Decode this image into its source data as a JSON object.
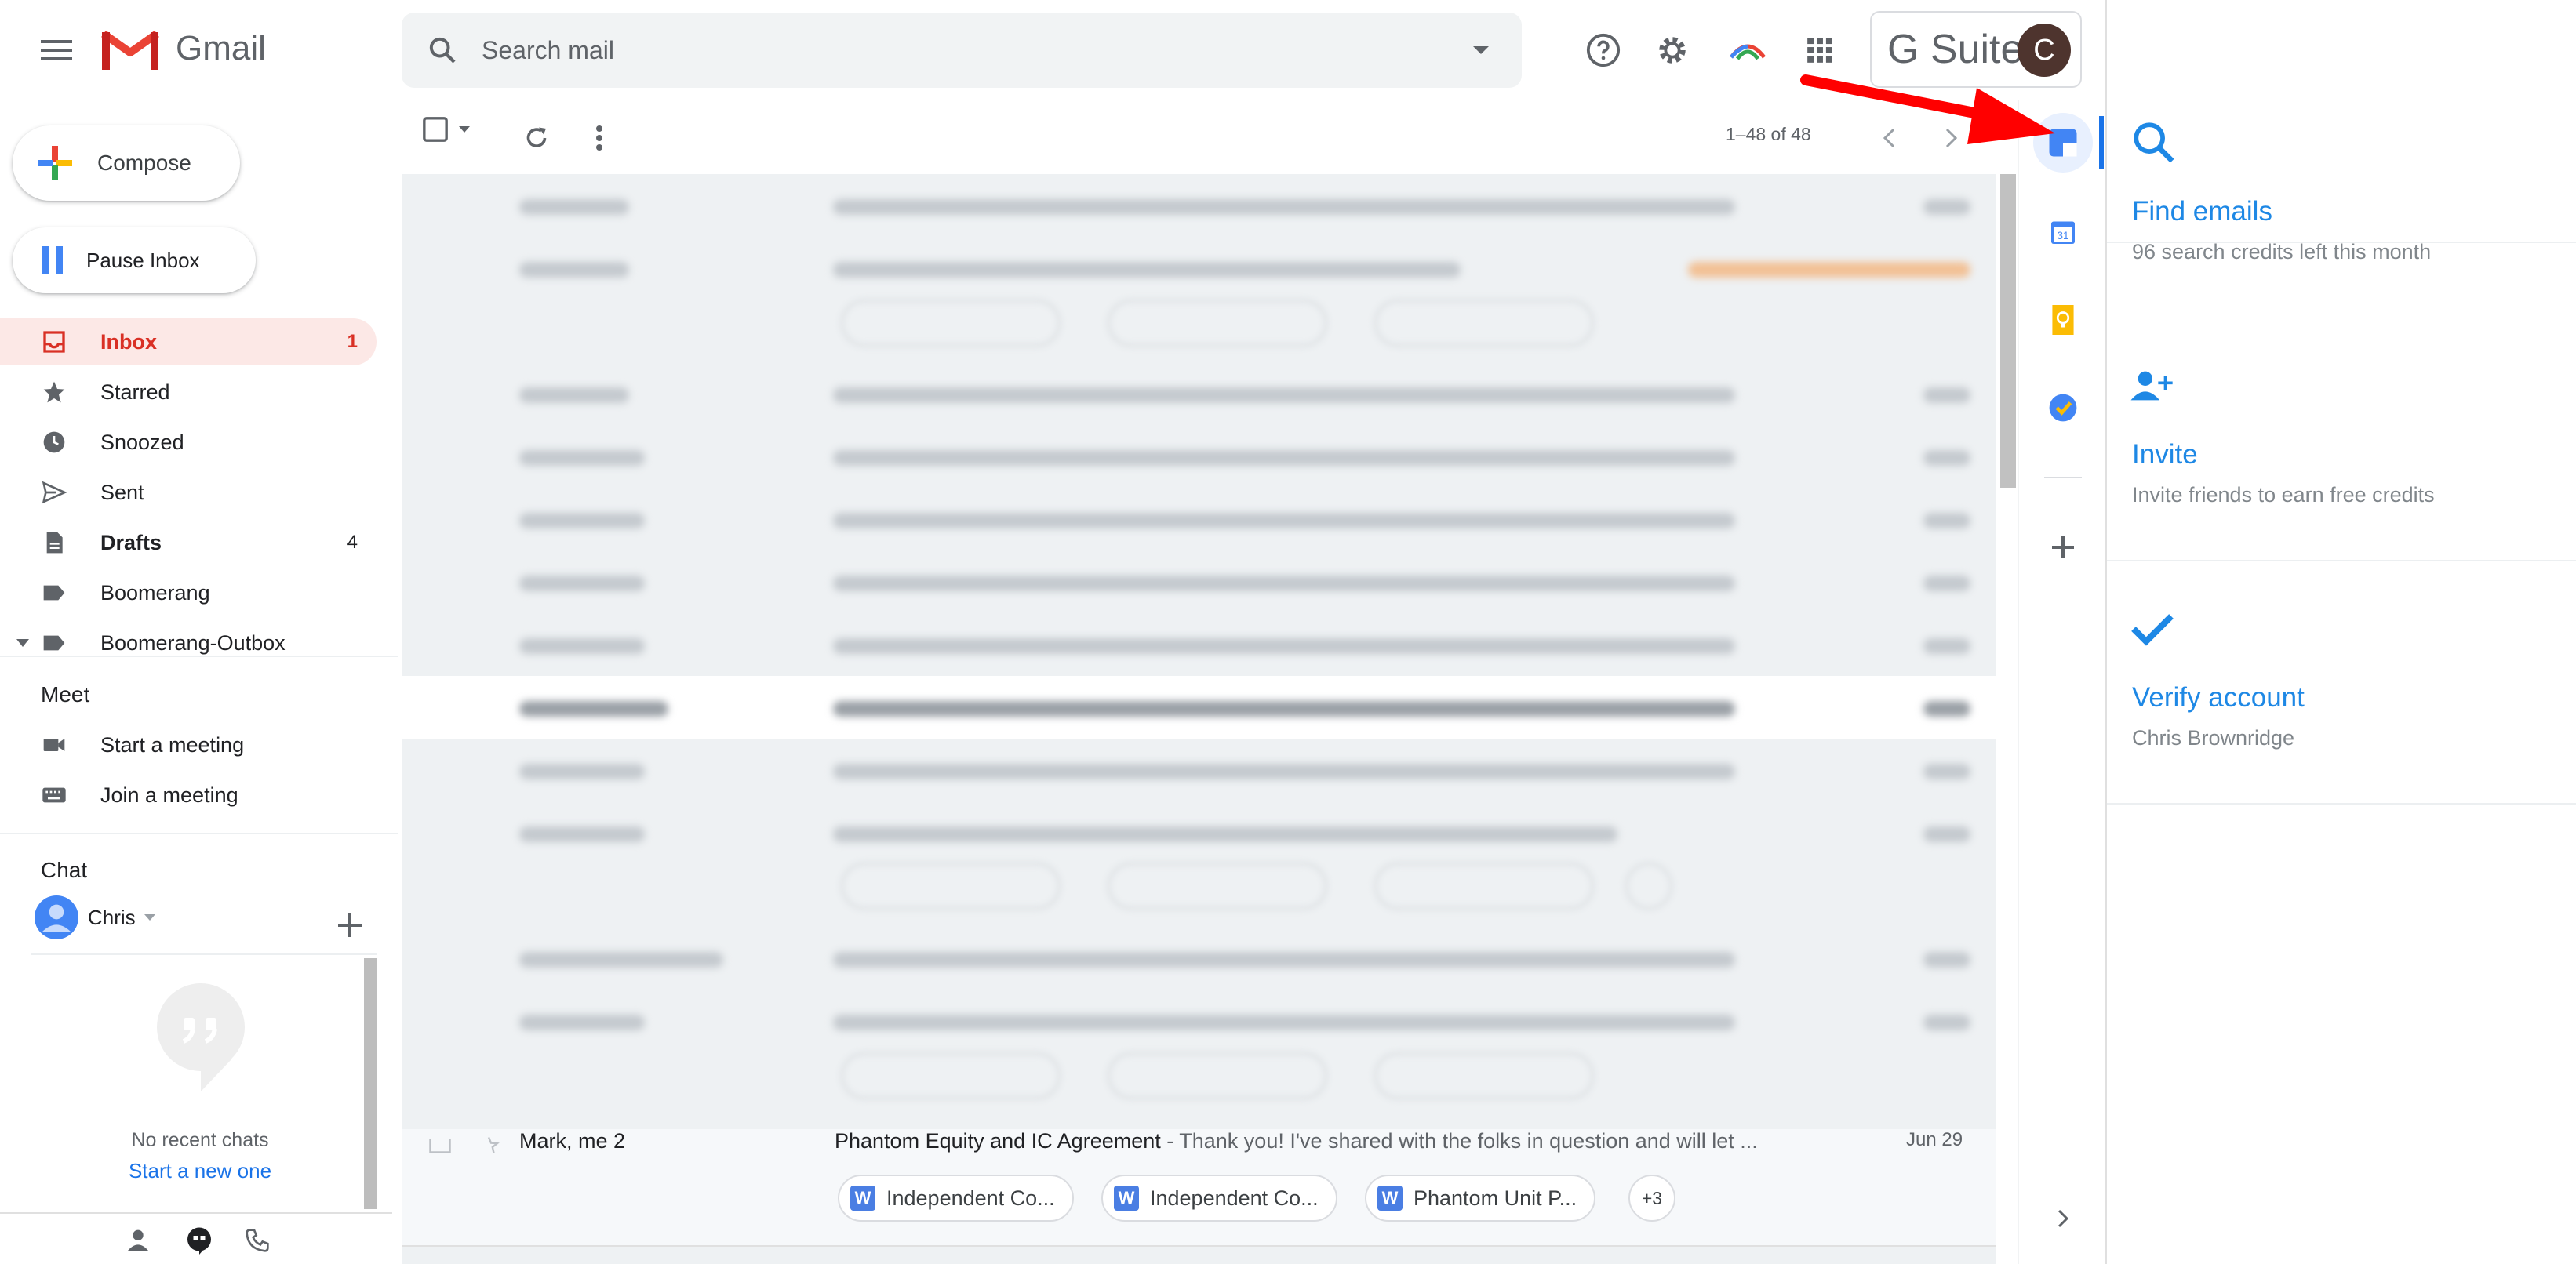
{
  "app": {
    "name": "Gmail"
  },
  "search": {
    "placeholder": "Search mail"
  },
  "header": {
    "gsuite_label": "G Suite",
    "avatar_letter": "C"
  },
  "compose": {
    "label": "Compose"
  },
  "pause": {
    "label": "Pause Inbox"
  },
  "nav": {
    "items": [
      {
        "label": "Inbox",
        "count": "1"
      },
      {
        "label": "Starred",
        "count": ""
      },
      {
        "label": "Snoozed",
        "count": ""
      },
      {
        "label": "Sent",
        "count": ""
      },
      {
        "label": "Drafts",
        "count": "4"
      },
      {
        "label": "Boomerang",
        "count": ""
      },
      {
        "label": "Boomerang-Outbox",
        "count": ""
      }
    ]
  },
  "meet": {
    "title": "Meet",
    "start": "Start a meeting",
    "join": "Join a meeting"
  },
  "chat": {
    "title": "Chat",
    "user": "Chris",
    "empty": "No recent chats",
    "start_new": "Start a new one"
  },
  "toolbar": {
    "page_count": "1–48 of 48"
  },
  "visible_email": {
    "sender": "Mark, me 2",
    "subject": "Phantom Equity and IC Agreement",
    "snippet": " - Thank you! I've shared with the folks in question and will let ...",
    "date": "Jun 29",
    "attachments": [
      "Independent Co...",
      "Independent Co...",
      "Phantom Unit P..."
    ],
    "more": "+3"
  },
  "right_panel": {
    "sections": [
      {
        "icon": "search-icon",
        "title": "Find emails",
        "subtitle": "96 search credits left this month"
      },
      {
        "icon": "add-person-icon",
        "title": "Invite",
        "subtitle": "Invite friends to earn free credits"
      },
      {
        "icon": "checkmark-icon",
        "title": "Verify account",
        "subtitle": "Chris Brownridge"
      }
    ]
  },
  "colors": {
    "inbox_accent": "#d93025",
    "link_blue": "#1e88e5",
    "gmail_red": "#ea4335",
    "arrow_red": "#ff0000"
  }
}
